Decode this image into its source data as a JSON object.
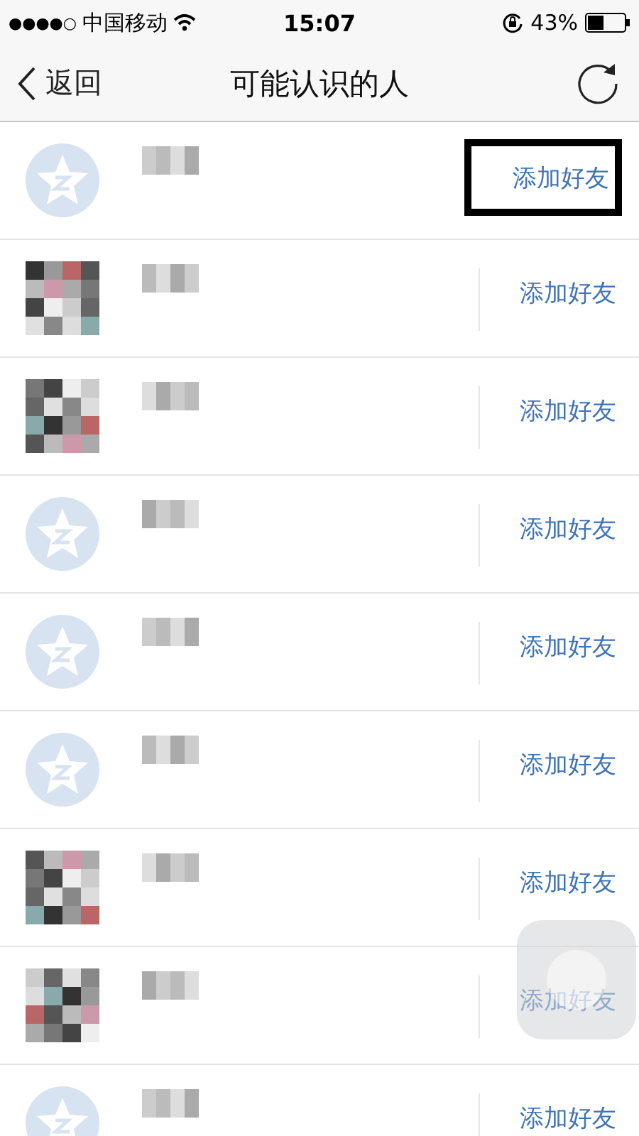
{
  "status_bar": {
    "signal_dots": "●●●●○",
    "carrier": "中国移动",
    "time": "15:07",
    "battery": "43%"
  },
  "nav": {
    "back": "返回",
    "title": "可能认识的人"
  },
  "people": [
    {
      "kind": "default",
      "action": "添加好友",
      "highlighted": true
    },
    {
      "kind": "photo",
      "action": "添加好友",
      "highlighted": false
    },
    {
      "kind": "photo",
      "action": "添加好友",
      "highlighted": false
    },
    {
      "kind": "default",
      "action": "添加好友",
      "highlighted": false
    },
    {
      "kind": "default",
      "action": "添加好友",
      "highlighted": false
    },
    {
      "kind": "default",
      "action": "添加好友",
      "highlighted": false
    },
    {
      "kind": "photo",
      "action": "添加好友",
      "highlighted": false
    },
    {
      "kind": "photo",
      "action": "添加好友",
      "highlighted": false
    },
    {
      "kind": "default",
      "action": "添加好友",
      "highlighted": false
    }
  ]
}
